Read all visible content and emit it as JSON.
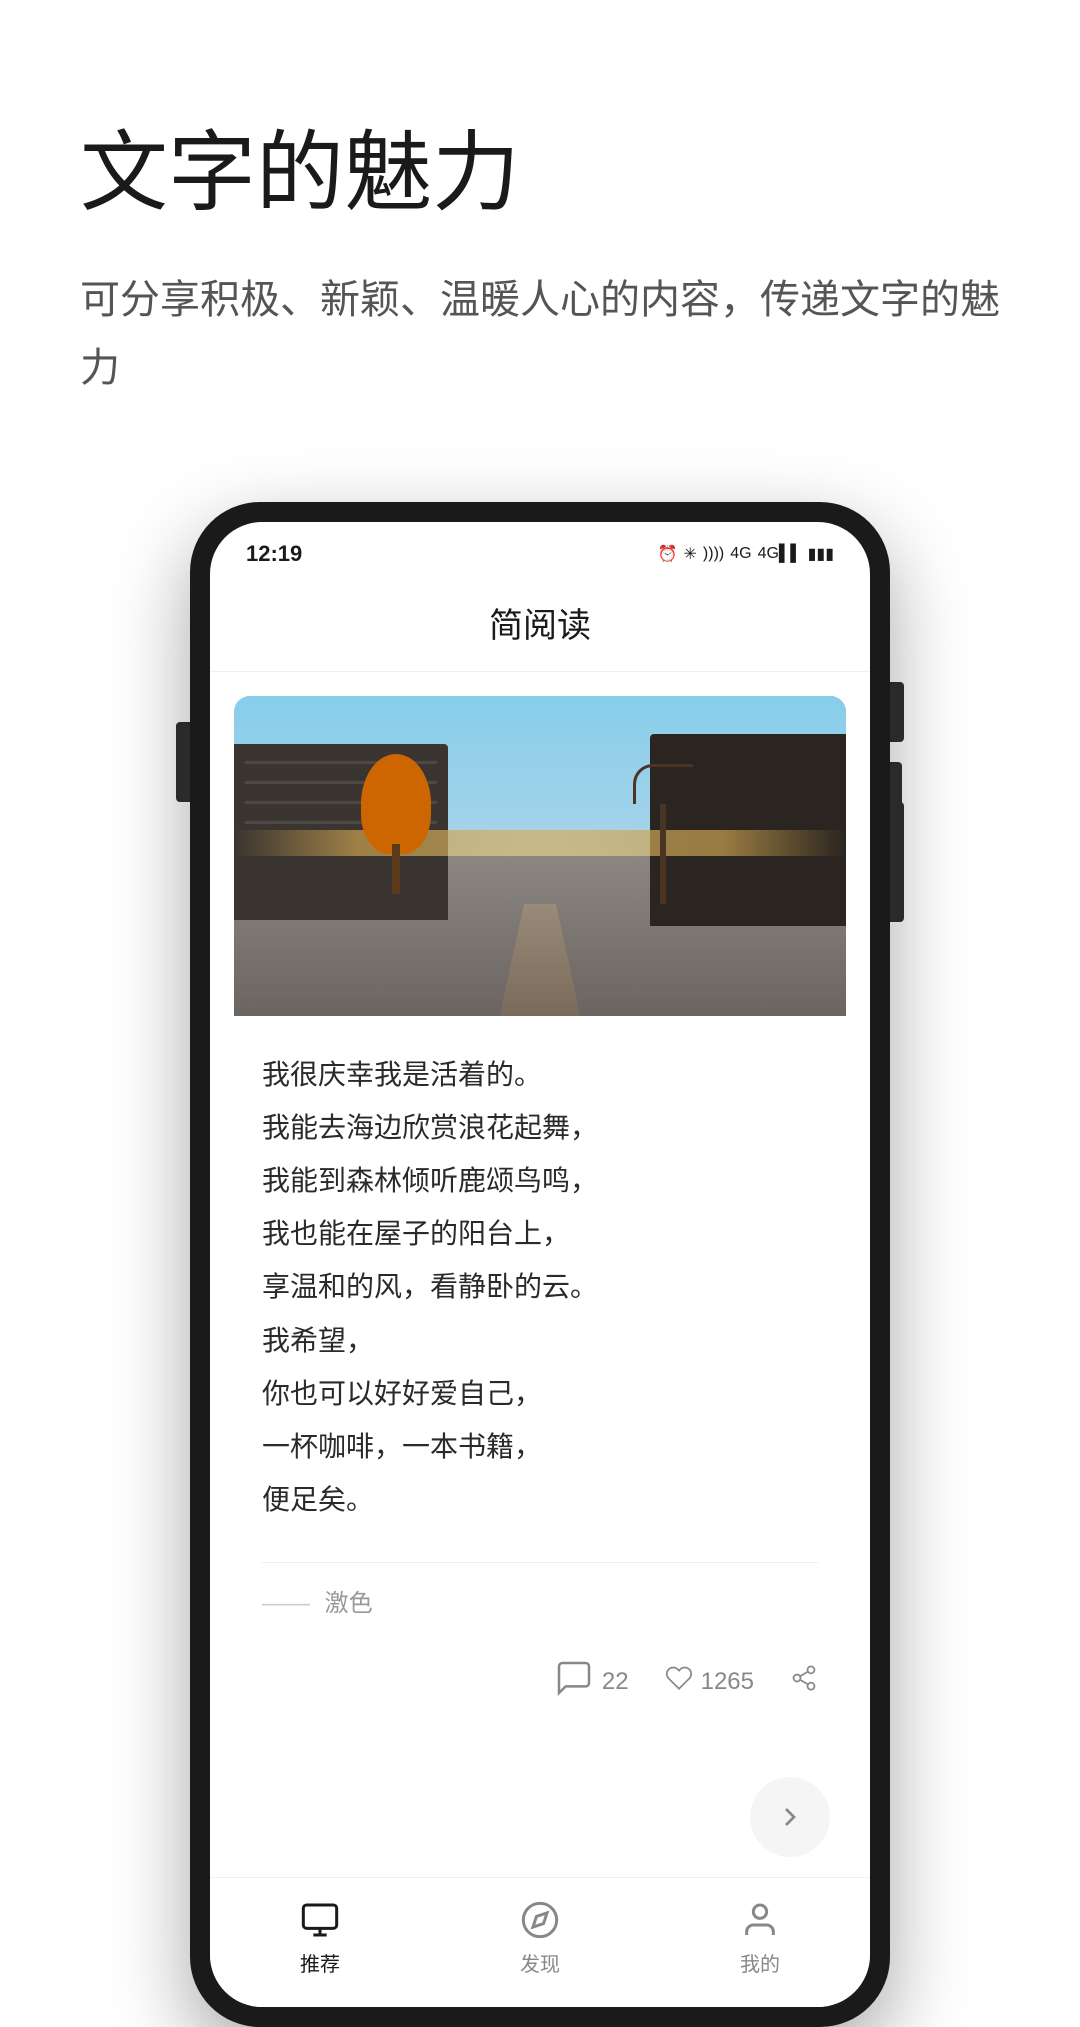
{
  "page": {
    "background": "#ffffff"
  },
  "header": {
    "main_title": "文字的魅力",
    "sub_title": "可分享积极、新颖、温暖人心的内容，传递文字的魅力"
  },
  "phone": {
    "status_bar": {
      "time": "12:19",
      "network_icon": "N",
      "icons": "⏰ ✳ ))) 4G 4G 🔋"
    },
    "app_title": "简阅读",
    "article": {
      "poem_lines": [
        "我很庆幸我是活着的。",
        "我能去海边欣赏浪花起舞，",
        "我能到森林倾听鹿颂鸟鸣，",
        "我也能在屋子的阳台上，",
        "享温和的风，看静卧的云。",
        "我希望，",
        "你也可以好好爱自己，",
        "一杯咖啡，一本书籍，",
        "便足矣。"
      ],
      "author": "激色",
      "comments_count": "22",
      "likes_count": "1265"
    },
    "bottom_nav": {
      "items": [
        {
          "id": "recommend",
          "label": "推荐",
          "active": true
        },
        {
          "id": "discover",
          "label": "发现",
          "active": false
        },
        {
          "id": "profile",
          "label": "我的",
          "active": false
        }
      ]
    }
  },
  "icons": {
    "comment": "💬",
    "heart": "♡",
    "share": "↗",
    "next_arrow": "›"
  }
}
